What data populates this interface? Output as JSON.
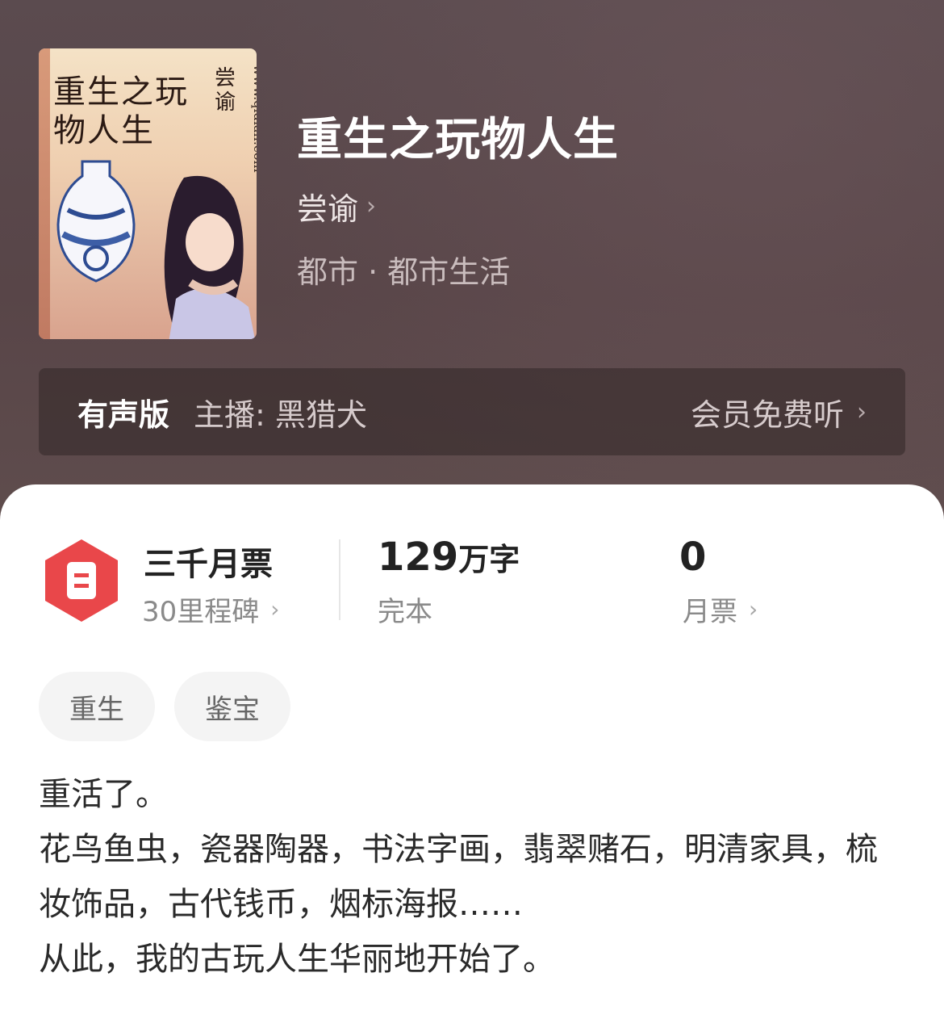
{
  "book": {
    "title": "重生之玩物人生",
    "author": "尝谕",
    "genre": "都市 · 都市生活",
    "cover": {
      "title_text": "重生之玩物人生",
      "author_text": "尝谕",
      "site_text": "www.qidian.com"
    }
  },
  "audio": {
    "label": "有声版",
    "narrator": "主播: 黑猎犬",
    "action": "会员免费听"
  },
  "stats": {
    "milestone_title": "三千月票",
    "milestone_sub": "30里程碑",
    "words_num": "129",
    "words_unit": "万字",
    "status": "完本",
    "monthly_tickets": "0",
    "monthly_label": "月票"
  },
  "tags": [
    "重生",
    "鉴宝"
  ],
  "synopsis": [
    "重活了。",
    "花鸟鱼虫，瓷器陶器，书法字画，翡翠赌石，明清家具，梳妆饰品，古代钱币，烟标海报……",
    "从此，我的古玩人生华丽地开始了。"
  ],
  "icons": {
    "chevron": "chevron-right-icon",
    "ticket": "ticket-icon"
  },
  "colors": {
    "hero_bg": "#5b4b4f",
    "badge_red": "#e9474a",
    "panel_bg": "#ffffff"
  }
}
